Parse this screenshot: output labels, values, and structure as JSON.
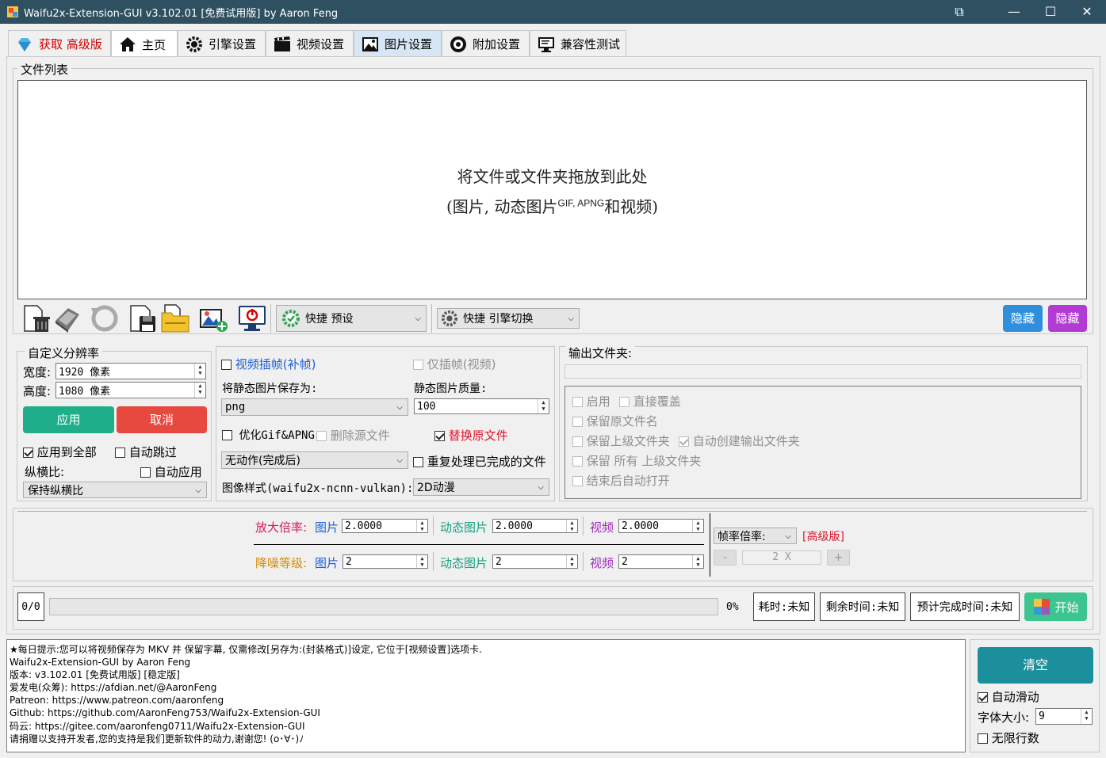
{
  "window": {
    "title": "Waifu2x-Extension-GUI v3.102.01 [免费试用版] by Aaron Feng",
    "controls": [
      "restore-down-icon",
      "minimize-icon",
      "maximize-icon",
      "close-icon"
    ]
  },
  "tabs": [
    {
      "label": "获取  高级版",
      "icon": "diamond-icon"
    },
    {
      "label": "主页",
      "icon": "home-icon"
    },
    {
      "label": "引擎设置",
      "icon": "engine-gear-icon"
    },
    {
      "label": "视频设置",
      "icon": "film-icon"
    },
    {
      "label": "图片设置",
      "icon": "picture-icon"
    },
    {
      "label": "附加设置",
      "icon": "settings-icon"
    },
    {
      "label": "兼容性测试",
      "icon": "monitor-test-icon"
    }
  ],
  "file_list": {
    "title": "文件列表",
    "drop_hint_line1": "将文件或文件夹拖放到此处",
    "drop_hint_line2_a": "(图片, 动态图片",
    "drop_hint_line2_sup": "GIF, APNG",
    "drop_hint_line2_b": "和视频)"
  },
  "toolbar": {
    "preset_label": "快捷 预设",
    "engine_switch_label": "快捷 引擎切换",
    "hide_btn1": "隐藏",
    "hide_btn2": "隐藏"
  },
  "resolution": {
    "title": "自定义分辨率",
    "width_label": "宽度:",
    "width_value": "1920 像素",
    "height_label": "高度:",
    "height_value": "1080 像素",
    "apply": "应用",
    "cancel": "取消",
    "apply_all": "应用到全部",
    "auto_skip": "自动跳过",
    "aspect_label": "纵横比:",
    "auto_apply": "自动应用",
    "aspect_value": "保持纵横比"
  },
  "middle": {
    "video_interp": "视频插帧(补帧)",
    "interp_only": "仅插帧(视频)",
    "save_static_as": "将静态图片保存为:",
    "static_quality": "静态图片质量:",
    "format": "png",
    "quality": "100",
    "optimize_gif": "优化Gif&APNG",
    "delete_source": "删除源文件",
    "replace_source": "替换原文件",
    "after_action": "无动作(完成后)",
    "reprocess": "重复处理已完成的文件",
    "style_label": "图像样式(waifu2x-ncnn-vulkan):",
    "style_value": "2D动漫"
  },
  "output": {
    "title": "输出文件夹:",
    "enable": "启用",
    "overwrite": "直接覆盖",
    "keep_name": "保留原文件名",
    "keep_parent": "保留上级文件夹",
    "auto_create": "自动创建输出文件夹",
    "keep_all_parents": "保留 所有 上级文件夹",
    "auto_open": "结束后自动打开"
  },
  "scale": {
    "scale_label": "放大倍率:",
    "image": "图片",
    "animated": "动态图片",
    "video": "视频",
    "scale_image": "2.0000",
    "scale_animated": "2.0000",
    "scale_video": "2.0000",
    "denoise_label": "降噪等级:",
    "denoise_image": "2",
    "denoise_animated": "2",
    "denoise_video": "2",
    "fps_label": "帧率倍率:",
    "pro_label": "[高级版]",
    "fps_minus": "-",
    "fps_value": "2 X",
    "fps_plus": "+"
  },
  "progress": {
    "count": "0/0",
    "percent": "0%",
    "percent_value": 0,
    "elapsed": "耗时:未知",
    "remaining": "剩余时间:未知",
    "eta": "预计完成时间:未知",
    "start": "开始"
  },
  "log": {
    "lines": [
      "★每日提示:您可以将视频保存为 MKV 并 保留字幕, 仅需修改[另存为:(封装格式)]设定, 它位于[视频设置]选项卡.",
      "Waifu2x-Extension-GUI by Aaron Feng",
      "版本: v3.102.01 [免费试用版] [稳定版]",
      "爱发电(众筹): https://afdian.net/@AaronFeng",
      "Patreon: https://www.patreon.com/aaronfeng",
      "Github: https://github.com/AaronFeng753/Waifu2x-Extension-GUI",
      "码云: https://gitee.com/aaronfeng0711/Waifu2x-Extension-GUI",
      "请捐赠以支持开发者,您的支持是我们更新软件的动力,谢谢您! (o･∀･)ﾉ"
    ]
  },
  "side": {
    "clear": "清空",
    "auto_scroll": "自动滑动",
    "font_size_label": "字体大小:",
    "font_size": "9",
    "unlimited": "无限行数"
  },
  "colors": {
    "titlebar": "#2f5060",
    "teal_button": "#1fae8a",
    "red_button": "#e8493f",
    "blue_button": "#2f8fdd",
    "purple_button": "#b23bd3",
    "clear_button": "#1c8f9c",
    "start_button": "#3cc58f"
  }
}
